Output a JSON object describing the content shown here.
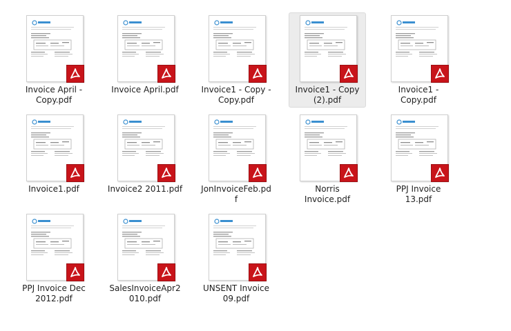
{
  "explorer": {
    "view": "large-icons",
    "selected_file": "Invoice1 - Copy (2).pdf",
    "files": [
      {
        "name": "Invoice April - Copy.pdf",
        "line1": "Invoice April -",
        "line2": "Copy.pdf",
        "icon": "pdf-icon"
      },
      {
        "name": "Invoice April.pdf",
        "line1": "Invoice April.pdf",
        "line2": "",
        "icon": "pdf-icon"
      },
      {
        "name": "Invoice1 - Copy - Copy.pdf",
        "line1": "Invoice1 - Copy -",
        "line2": "Copy.pdf",
        "icon": "pdf-icon"
      },
      {
        "name": "Invoice1 - Copy (2).pdf",
        "line1": "Invoice1 - Copy",
        "line2": "(2).pdf",
        "icon": "pdf-icon"
      },
      {
        "name": "Invoice1 - Copy.pdf",
        "line1": "Invoice1 -",
        "line2": "Copy.pdf",
        "icon": "pdf-icon"
      },
      {
        "name": "Invoice1.pdf",
        "line1": "Invoice1.pdf",
        "line2": "",
        "icon": "pdf-icon"
      },
      {
        "name": "Invoice2 2011.pdf",
        "line1": "Invoice2 2011.pdf",
        "line2": "",
        "icon": "pdf-icon"
      },
      {
        "name": "JonInvoiceFeb.pdf",
        "line1": "JonInvoiceFeb.pd",
        "line2": "f",
        "icon": "pdf-icon"
      },
      {
        "name": "Norris Invoice.pdf",
        "line1": "Norris",
        "line2": "Invoice.pdf",
        "icon": "pdf-icon"
      },
      {
        "name": "PPJ Invoice 13.pdf",
        "line1": "PPJ Invoice",
        "line2": "13.pdf",
        "icon": "pdf-icon"
      },
      {
        "name": "PPJ Invoice Dec 2012.pdf",
        "line1": "PPJ Invoice Dec",
        "line2": "2012.pdf",
        "icon": "pdf-icon"
      },
      {
        "name": "SalesInvoiceApr2010.pdf",
        "line1": "SalesInvoiceApr2",
        "line2": "010.pdf",
        "icon": "pdf-icon"
      },
      {
        "name": "UNSENT Invoice 09.pdf",
        "line1": "UNSENT Invoice",
        "line2": "09.pdf",
        "icon": "pdf-icon"
      }
    ],
    "colors": {
      "pdf_badge": "#c8141a",
      "selection_bg": "#ececec",
      "preview_logo": "#3a8fd0"
    }
  }
}
